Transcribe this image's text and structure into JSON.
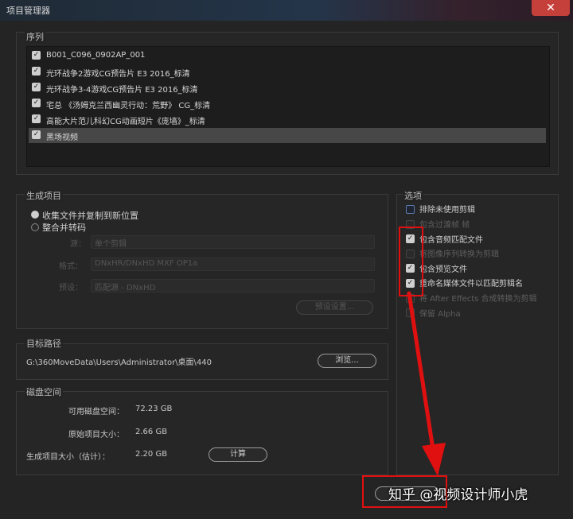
{
  "window": {
    "title": "项目管理器",
    "close_glyph": "✕"
  },
  "sequences": {
    "label": "序列",
    "items": [
      {
        "label": "B001_C096_0902AP_001",
        "checked": true
      },
      {
        "label": "光环战争2游戏CG预告片 E3 2016_标清",
        "checked": true
      },
      {
        "label": "光环战争3-4游戏CG预告片 E3 2016_标清",
        "checked": true
      },
      {
        "label": "宅总 《汤姆克兰西幽灵行动：荒野》 CG_标清",
        "checked": true
      },
      {
        "label": "高能大片范儿科幻CG动画短片《庞墙》_标清",
        "checked": true
      },
      {
        "label": "黑场视频",
        "checked": true
      }
    ],
    "selected_index": 5
  },
  "generate": {
    "label": "生成项目",
    "option_collect": "收集文件并复制到新位置",
    "option_consolidate": "整合并转码",
    "selected": "collect",
    "source_label": "源：",
    "source_value": "单个剪辑",
    "format_label": "格式：",
    "format_value": "DNxHR/DNxHD MXF OP1a",
    "preset_label": "预设：",
    "preset_value": "匹配源 - DNxHD",
    "preset_settings_button": "预设设置..."
  },
  "options": {
    "label": "选项",
    "items": [
      {
        "label": "排除未使用剪辑",
        "state": "unchecked",
        "enabled": true
      },
      {
        "label": "包含过渡帧   帧",
        "state": "unchecked",
        "enabled": false
      },
      {
        "label": "包含音频匹配文件",
        "state": "checked",
        "enabled": true
      },
      {
        "label": "将图像序列转换为剪辑",
        "state": "unchecked",
        "enabled": false
      },
      {
        "label": "包含预览文件",
        "state": "checked",
        "enabled": true
      },
      {
        "label": "重命名媒体文件以匹配剪辑名",
        "state": "checked",
        "enabled": true
      },
      {
        "label": "将 After Effects 合成转换为剪辑",
        "state": "unchecked",
        "enabled": false
      },
      {
        "label": "保留 Alpha",
        "state": "unchecked",
        "enabled": false
      }
    ]
  },
  "target": {
    "label": "目标路径",
    "path": "G:\\360MoveData\\Users\\Administrator\\桌面\\440",
    "browse_button": "浏览..."
  },
  "disk": {
    "label": "磁盘空间",
    "available_label": "可用磁盘空间：",
    "available_value": "72.23 GB",
    "original_label": "原始项目大小：",
    "original_value": "2.66 GB",
    "generated_label": "生成项目大小（估计）：",
    "generated_value": "2.20 GB",
    "compute_button": "计算"
  },
  "watermark": "知乎 @视频设计师小虎",
  "colors": {
    "annotation_red": "#e01010",
    "close_red": "#c6403b"
  }
}
